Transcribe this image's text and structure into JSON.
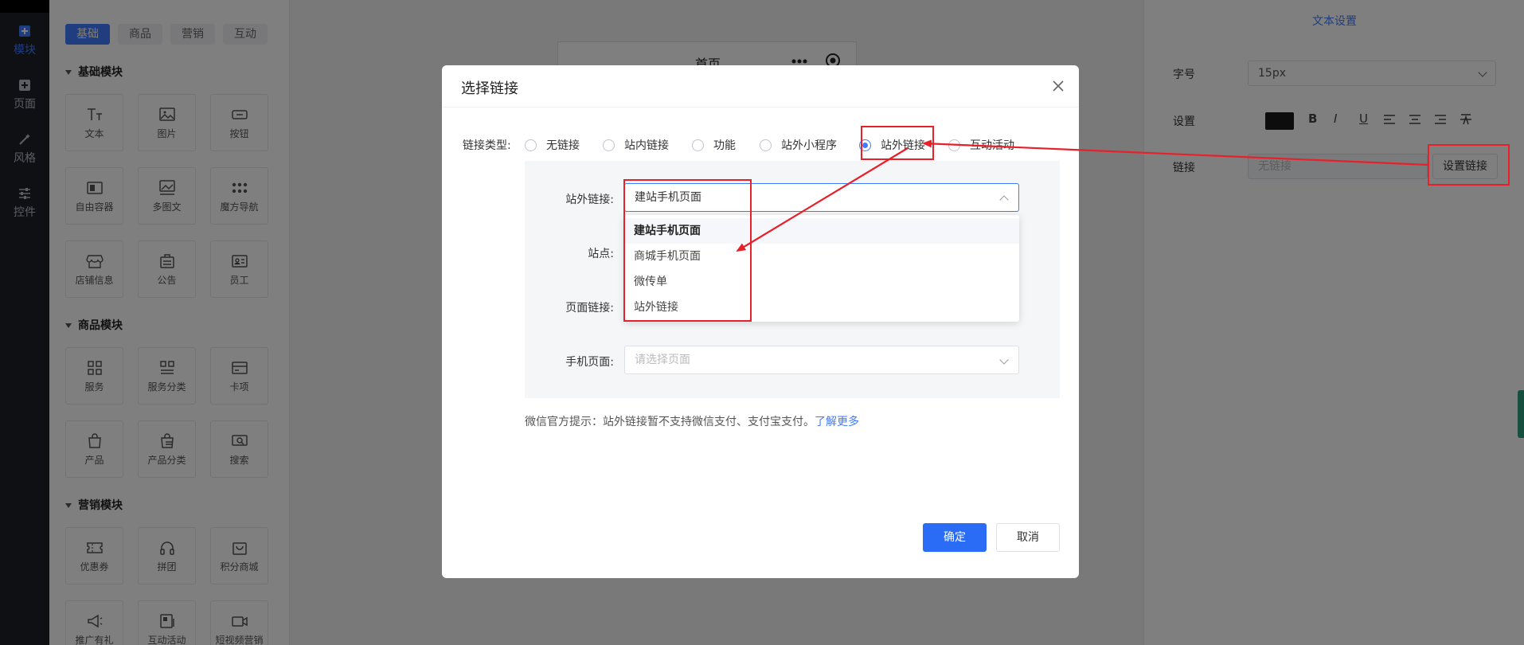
{
  "rail": {
    "items": [
      {
        "label": "模块",
        "icon": "plus-square-icon",
        "active": true
      },
      {
        "label": "页面",
        "icon": "plus-square-icon"
      },
      {
        "label": "风格",
        "icon": "magic-wand-icon"
      },
      {
        "label": "控件",
        "icon": "sliders-icon"
      }
    ]
  },
  "panel": {
    "tabs": [
      "基础",
      "商品",
      "营销",
      "互动"
    ],
    "sections": {
      "basic": {
        "title": "基础模块",
        "items": [
          "文本",
          "图片",
          "按钮",
          "自由容器",
          "多图文",
          "魔方导航",
          "店铺信息",
          "公告",
          "员工"
        ]
      },
      "goods": {
        "title": "商品模块",
        "items": [
          "服务",
          "服务分类",
          "卡项",
          "产品",
          "产品分类",
          "搜索"
        ]
      },
      "marketing": {
        "title": "营销模块",
        "items": [
          "优惠券",
          "拼团",
          "积分商城",
          "推广有礼",
          "互动活动",
          "短视频营销"
        ]
      }
    }
  },
  "phone": {
    "title": "首页"
  },
  "settings": {
    "title": "文本设置",
    "font_size_label": "字号",
    "font_size_value": "15px",
    "style_label": "设置",
    "swatch_color": "#1a1a1a",
    "format_buttons": [
      "B",
      "I",
      "U"
    ],
    "link_label": "链接",
    "link_placeholder": "无链接",
    "set_link_button": "设置链接"
  },
  "dialog": {
    "title": "选择链接",
    "link_type_label": "链接类型:",
    "link_types": [
      "无链接",
      "站内链接",
      "功能",
      "站外小程序",
      "站外链接",
      "互动活动"
    ],
    "selected_link_type": "站外链接",
    "fields": {
      "external_link_label": "站外链接:",
      "external_link_value": "建站手机页面",
      "site_label": "站点:",
      "page_link_label": "页面链接:",
      "mobile_page_label": "手机页面:",
      "mobile_page_placeholder": "请选择页面"
    },
    "dropdown_options": [
      "建站手机页面",
      "商城手机页面",
      "微传单",
      "站外链接"
    ],
    "tip_text": "微信官方提示：站外链接暂不支持微信支付、支付宝支付。",
    "tip_link": "了解更多",
    "ok_button": "确定",
    "cancel_button": "取消"
  },
  "colors": {
    "accent": "#3e7bff",
    "primary_button": "#2b6cf6",
    "annotation": "#e8202a",
    "rail_bg": "#1f2129"
  }
}
